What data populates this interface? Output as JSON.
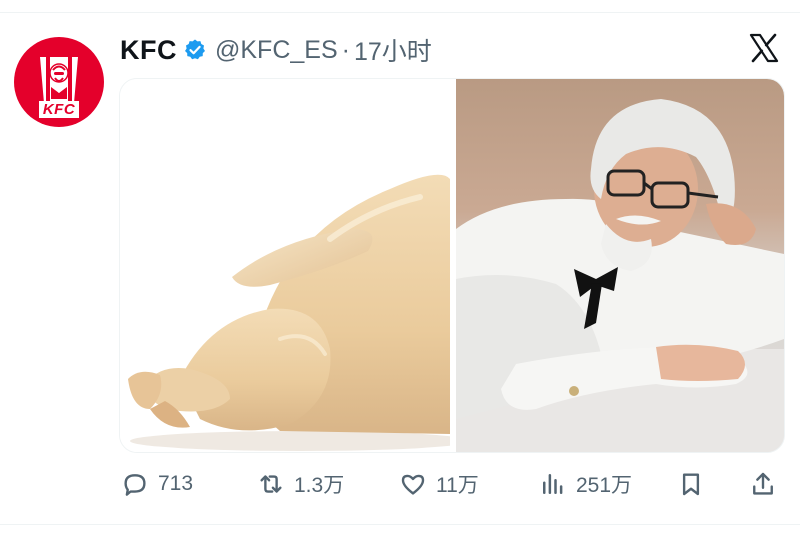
{
  "tweet": {
    "author_name": "KFC",
    "handle": "@KFC_ES",
    "separator": "·",
    "time": "17小时",
    "avatar_text": "KFC",
    "verified": true
  },
  "media": {
    "left_image": "raw-whole-chicken",
    "right_image": "man-dressed-as-colonel-lying-on-floor"
  },
  "actions": {
    "replies": "713",
    "reposts": "1.3万",
    "likes": "11万",
    "views": "251万"
  },
  "icons": {
    "reply": "speech-bubble-icon",
    "repost": "repost-arrows-icon",
    "like": "heart-icon",
    "views": "bar-chart-icon",
    "bookmark": "bookmark-icon",
    "share": "share-upload-icon",
    "platform": "x-logo-icon",
    "verified": "verified-badge-icon"
  },
  "colors": {
    "brand_red": "#e4002b",
    "verified_blue": "#1d9bf0",
    "muted_text": "#536471",
    "primary_text": "#0f1419"
  }
}
